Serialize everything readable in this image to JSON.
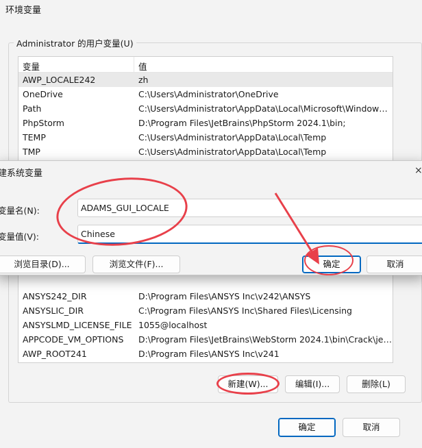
{
  "window": {
    "title": "环境变量"
  },
  "user_vars": {
    "group_label": "Administrator 的用户变量(U)",
    "col_name": "变量",
    "col_value": "值",
    "rows": [
      {
        "name": "AWP_LOCALE242",
        "value": "zh"
      },
      {
        "name": "OneDrive",
        "value": "C:\\Users\\Administrator\\OneDrive"
      },
      {
        "name": "Path",
        "value": "C:\\Users\\Administrator\\AppData\\Local\\Microsoft\\WindowsA..."
      },
      {
        "name": "PhpStorm",
        "value": "D:\\Program Files\\JetBrains\\PhpStorm 2024.1\\bin;"
      },
      {
        "name": "TEMP",
        "value": "C:\\Users\\Administrator\\AppData\\Local\\Temp"
      },
      {
        "name": "TMP",
        "value": "C:\\Users\\Administrator\\AppData\\Local\\Temp"
      }
    ]
  },
  "new_var_dialog": {
    "title": "建系统变量",
    "name_label": "变量名(N):",
    "name_value": "ADAMS_GUI_LOCALE",
    "value_label": "变量值(V):",
    "value_value": "Chinese",
    "browse_dir": "浏览目录(D)...",
    "browse_file": "浏览文件(F)...",
    "ok": "确定",
    "cancel": "取消",
    "close_glyph": "×"
  },
  "sys_vars": {
    "rows": [
      {
        "name": "ANSYS242_DIR",
        "value": "D:\\Program Files\\ANSYS Inc\\v242\\ANSYS"
      },
      {
        "name": "ANSYSLIC_DIR",
        "value": "C:\\Program Files\\ANSYS Inc\\Shared Files\\Licensing"
      },
      {
        "name": "ANSYSLMD_LICENSE_FILE",
        "value": "1055@localhost"
      },
      {
        "name": "APPCODE_VM_OPTIONS",
        "value": "D:\\Program Files\\JetBrains\\WebStorm 2024.1\\bin\\Crack\\jetbr..."
      },
      {
        "name": "AWP_ROOT241",
        "value": "D:\\Program Files\\ANSYS Inc\\v241"
      }
    ],
    "new_button": "新建(W)...",
    "edit_button": "编辑(I)...",
    "delete_button": "删除(L)"
  },
  "footer": {
    "ok": "确定",
    "cancel": "取消"
  },
  "colors": {
    "accent": "#0067c0",
    "annotation": "#e8404a"
  }
}
